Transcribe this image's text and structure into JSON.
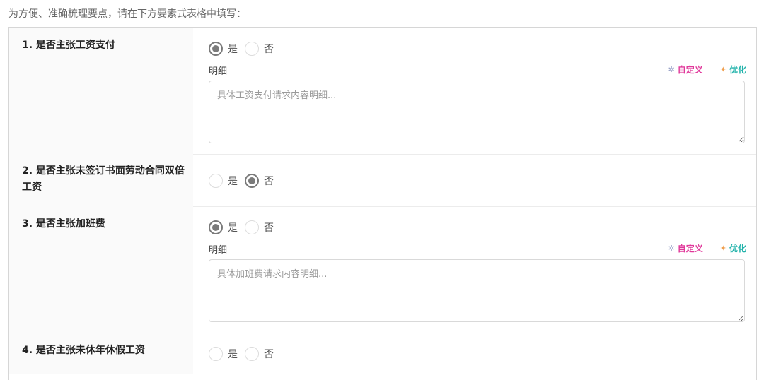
{
  "intro": "为方便、准确梳理要点，请在下方要素式表格中填写：",
  "options": {
    "yes": "是",
    "no": "否"
  },
  "detail_label": "明细",
  "tools": {
    "custom": "自定义",
    "optimize": "优化"
  },
  "rows": [
    {
      "title": "1. 是否主张工资支付",
      "selected": "yes",
      "placeholder": "具体工资支付请求内容明细..."
    },
    {
      "title": "2. 是否主张未签订书面劳动合同双倍工资",
      "selected": "no"
    },
    {
      "title": "3. 是否主张加班费",
      "selected": "yes",
      "placeholder": "具体加班费请求内容明细..."
    },
    {
      "title": "4. 是否主张未休年休假工资",
      "selected": "none"
    }
  ]
}
